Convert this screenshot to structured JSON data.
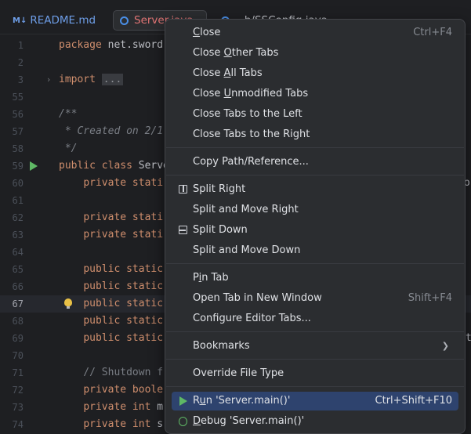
{
  "tabs": [
    {
      "badge": "M↓",
      "label": "README.md"
    },
    {
      "label": "Server.java"
    },
    {
      "label": "...h/SSConfig.java"
    }
  ],
  "editor": {
    "lines": [
      {
        "num": "1",
        "code": "package net.sword"
      },
      {
        "num": "2",
        "code": ""
      },
      {
        "num": "3",
        "code": "import ..."
      },
      {
        "num": "55",
        "code": ""
      },
      {
        "num": "56",
        "code": "/**"
      },
      {
        "num": "57",
        "code": " * Created on 2/1"
      },
      {
        "num": "58",
        "code": " */"
      },
      {
        "num": "59",
        "code": "public class Server"
      },
      {
        "num": "60",
        "code": "    private stati"
      },
      {
        "num": "61",
        "code": ""
      },
      {
        "num": "62",
        "code": "    private stati"
      },
      {
        "num": "63",
        "code": "    private stati"
      },
      {
        "num": "64",
        "code": ""
      },
      {
        "num": "65",
        "code": "    public static"
      },
      {
        "num": "66",
        "code": "    public static"
      },
      {
        "num": "67",
        "code": "    public static"
      },
      {
        "num": "68",
        "code": "    public static"
      },
      {
        "num": "69",
        "code": "    public static"
      },
      {
        "num": "70",
        "code": ""
      },
      {
        "num": "71",
        "code": "    // Shutdown f"
      },
      {
        "num": "72",
        "code": "    private boole"
      },
      {
        "num": "73",
        "code": "    private int m"
      },
      {
        "num": "74",
        "code": "    private int s"
      }
    ],
    "right_fragments": [
      "or",
      "t"
    ]
  },
  "context_menu": {
    "items": [
      {
        "label": "Close",
        "mnemonic_index": 0,
        "shortcut": "Ctrl+F4"
      },
      {
        "label": "Close Other Tabs",
        "mnemonic_index": 6
      },
      {
        "label": "Close All Tabs",
        "mnemonic_index": 6
      },
      {
        "label": "Close Unmodified Tabs",
        "mnemonic_index": 6
      },
      {
        "label": "Close Tabs to the Left"
      },
      {
        "label": "Close Tabs to the Right"
      },
      {
        "label": "Copy Path/Reference..."
      },
      {
        "label": "Split Right",
        "icon": "split-right-icon"
      },
      {
        "label": "Split and Move Right"
      },
      {
        "label": "Split Down",
        "icon": "split-down-icon"
      },
      {
        "label": "Split and Move Down"
      },
      {
        "label": "Pin Tab",
        "mnemonic_index": 1
      },
      {
        "label": "Open Tab in New Window",
        "shortcut": "Shift+F4"
      },
      {
        "label": "Configure Editor Tabs..."
      },
      {
        "label": "Bookmarks",
        "submenu": true
      },
      {
        "label": "Override File Type"
      },
      {
        "label": "Run 'Server.main()'",
        "mnemonic_index": 1,
        "shortcut": "Ctrl+Shift+F10",
        "icon": "run-icon",
        "selected": true
      },
      {
        "label": "Debug 'Server.main()'",
        "mnemonic_index": 0,
        "icon": "debug-icon"
      }
    ]
  },
  "colors": {
    "background": "#1e1f22",
    "menu_background": "#2b2d30",
    "selection": "#2e436e",
    "keyword": "#cf8e6d",
    "run_green": "#5fb865"
  }
}
